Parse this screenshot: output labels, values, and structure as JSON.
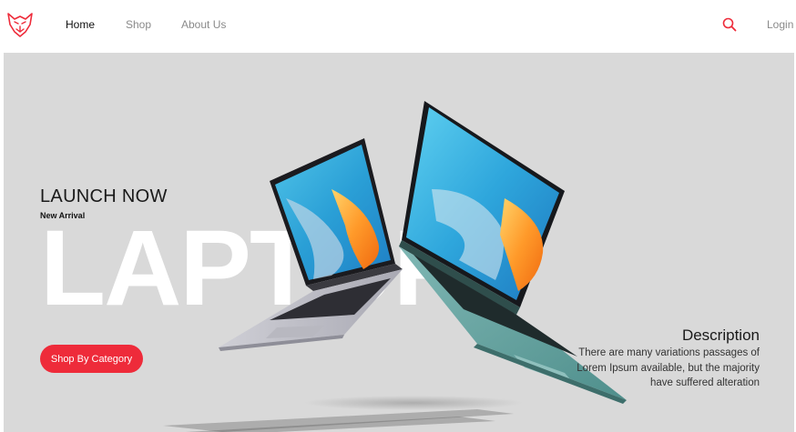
{
  "nav": {
    "items": [
      {
        "label": "Home"
      },
      {
        "label": "Shop"
      },
      {
        "label": "About Us"
      }
    ],
    "login_label": "Login",
    "logo_icon": "wolf-logo-icon",
    "search_icon": "search-icon"
  },
  "hero": {
    "title": "LAUNCH NOW",
    "subtitle": "New Arrival",
    "bg_word": "LAPTOP",
    "cta_label": "Shop By Category",
    "description_title": "Description",
    "description_text": "There are many variations passages of Lorem Ipsum available, but the majority have suffered alteration"
  },
  "colors": {
    "accent": "#ee2b3a",
    "hero_background": "#d9d9d9",
    "nav_active": "#111111",
    "nav_inactive": "#8a8a8a"
  }
}
